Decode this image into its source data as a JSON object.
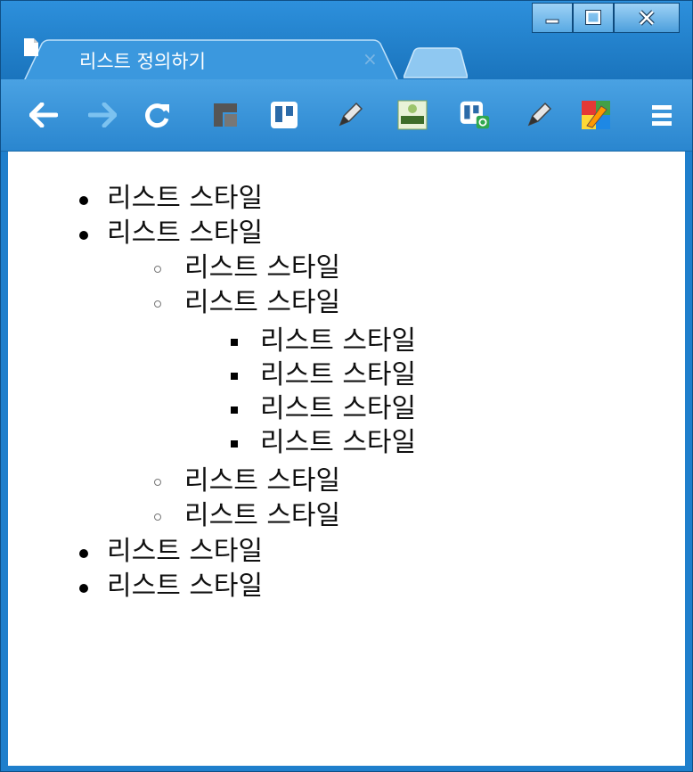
{
  "window": {
    "buttons": {
      "minimize": "_",
      "maximize": "□",
      "close": "x"
    }
  },
  "tab": {
    "title": "리스트 정의하기",
    "close_label": "×"
  },
  "toolbar": {
    "icons": [
      "back-icon",
      "forward-icon",
      "reload-icon",
      "extension-icon",
      "trello-icon",
      "pen-icon",
      "fast-access-icon",
      "trello-badge-icon",
      "pen-icon",
      "color-picker-icon",
      "menu-icon"
    ]
  },
  "list": {
    "level1_a": [
      "리스트 스타일",
      "리스트 스타일"
    ],
    "level2_a": [
      "리스트 스타일",
      "리스트 스타일"
    ],
    "level3": [
      "리스트 스타일",
      "리스트 스타일",
      "리스트 스타일",
      "리스트 스타일"
    ],
    "level2_b": [
      "리스트 스타일",
      "리스트 스타일"
    ],
    "level1_b": [
      "리스트 스타일",
      "리스트 스타일"
    ]
  }
}
